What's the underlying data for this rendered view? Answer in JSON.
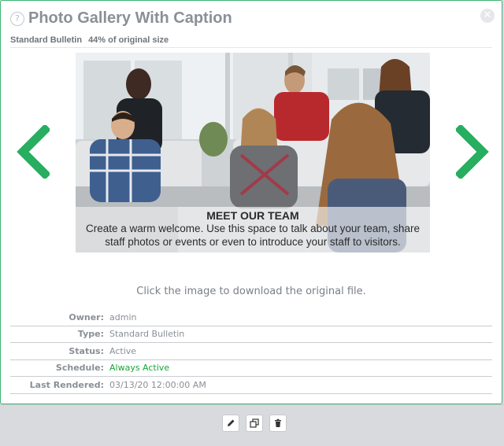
{
  "dialog": {
    "title": "Photo Gallery With Caption",
    "bulletin_type": "Standard Bulletin",
    "size_note": "44% of original size",
    "help_glyph": "?",
    "close_glyph": "✕"
  },
  "slide": {
    "caption_title": "MEET OUR TEAM",
    "caption_body": "Create a warm welcome. Use this space to talk about your team, share staff photos or events or even to introduce your staff to visitors."
  },
  "download_hint": "Click the image to download the original file.",
  "details": {
    "owner_label": "Owner:",
    "owner_value": "admin",
    "type_label": "Type:",
    "type_value": "Standard Bulletin",
    "status_label": "Status:",
    "status_value": "Active",
    "schedule_label": "Schedule:",
    "schedule_value": "Always Active",
    "rendered_label": "Last Rendered:",
    "rendered_value": "03/13/20 12:00:00 AM"
  },
  "icons": {
    "prev": "chevron-left-icon",
    "next": "chevron-right-icon",
    "edit": "pencil-icon",
    "copy": "copy-icon",
    "delete": "trash-icon"
  },
  "colors": {
    "accent_green": "#27ae60",
    "schedule_green": "#17a53a",
    "modal_border": "#3ab672",
    "muted_text": "#8a8f96"
  }
}
